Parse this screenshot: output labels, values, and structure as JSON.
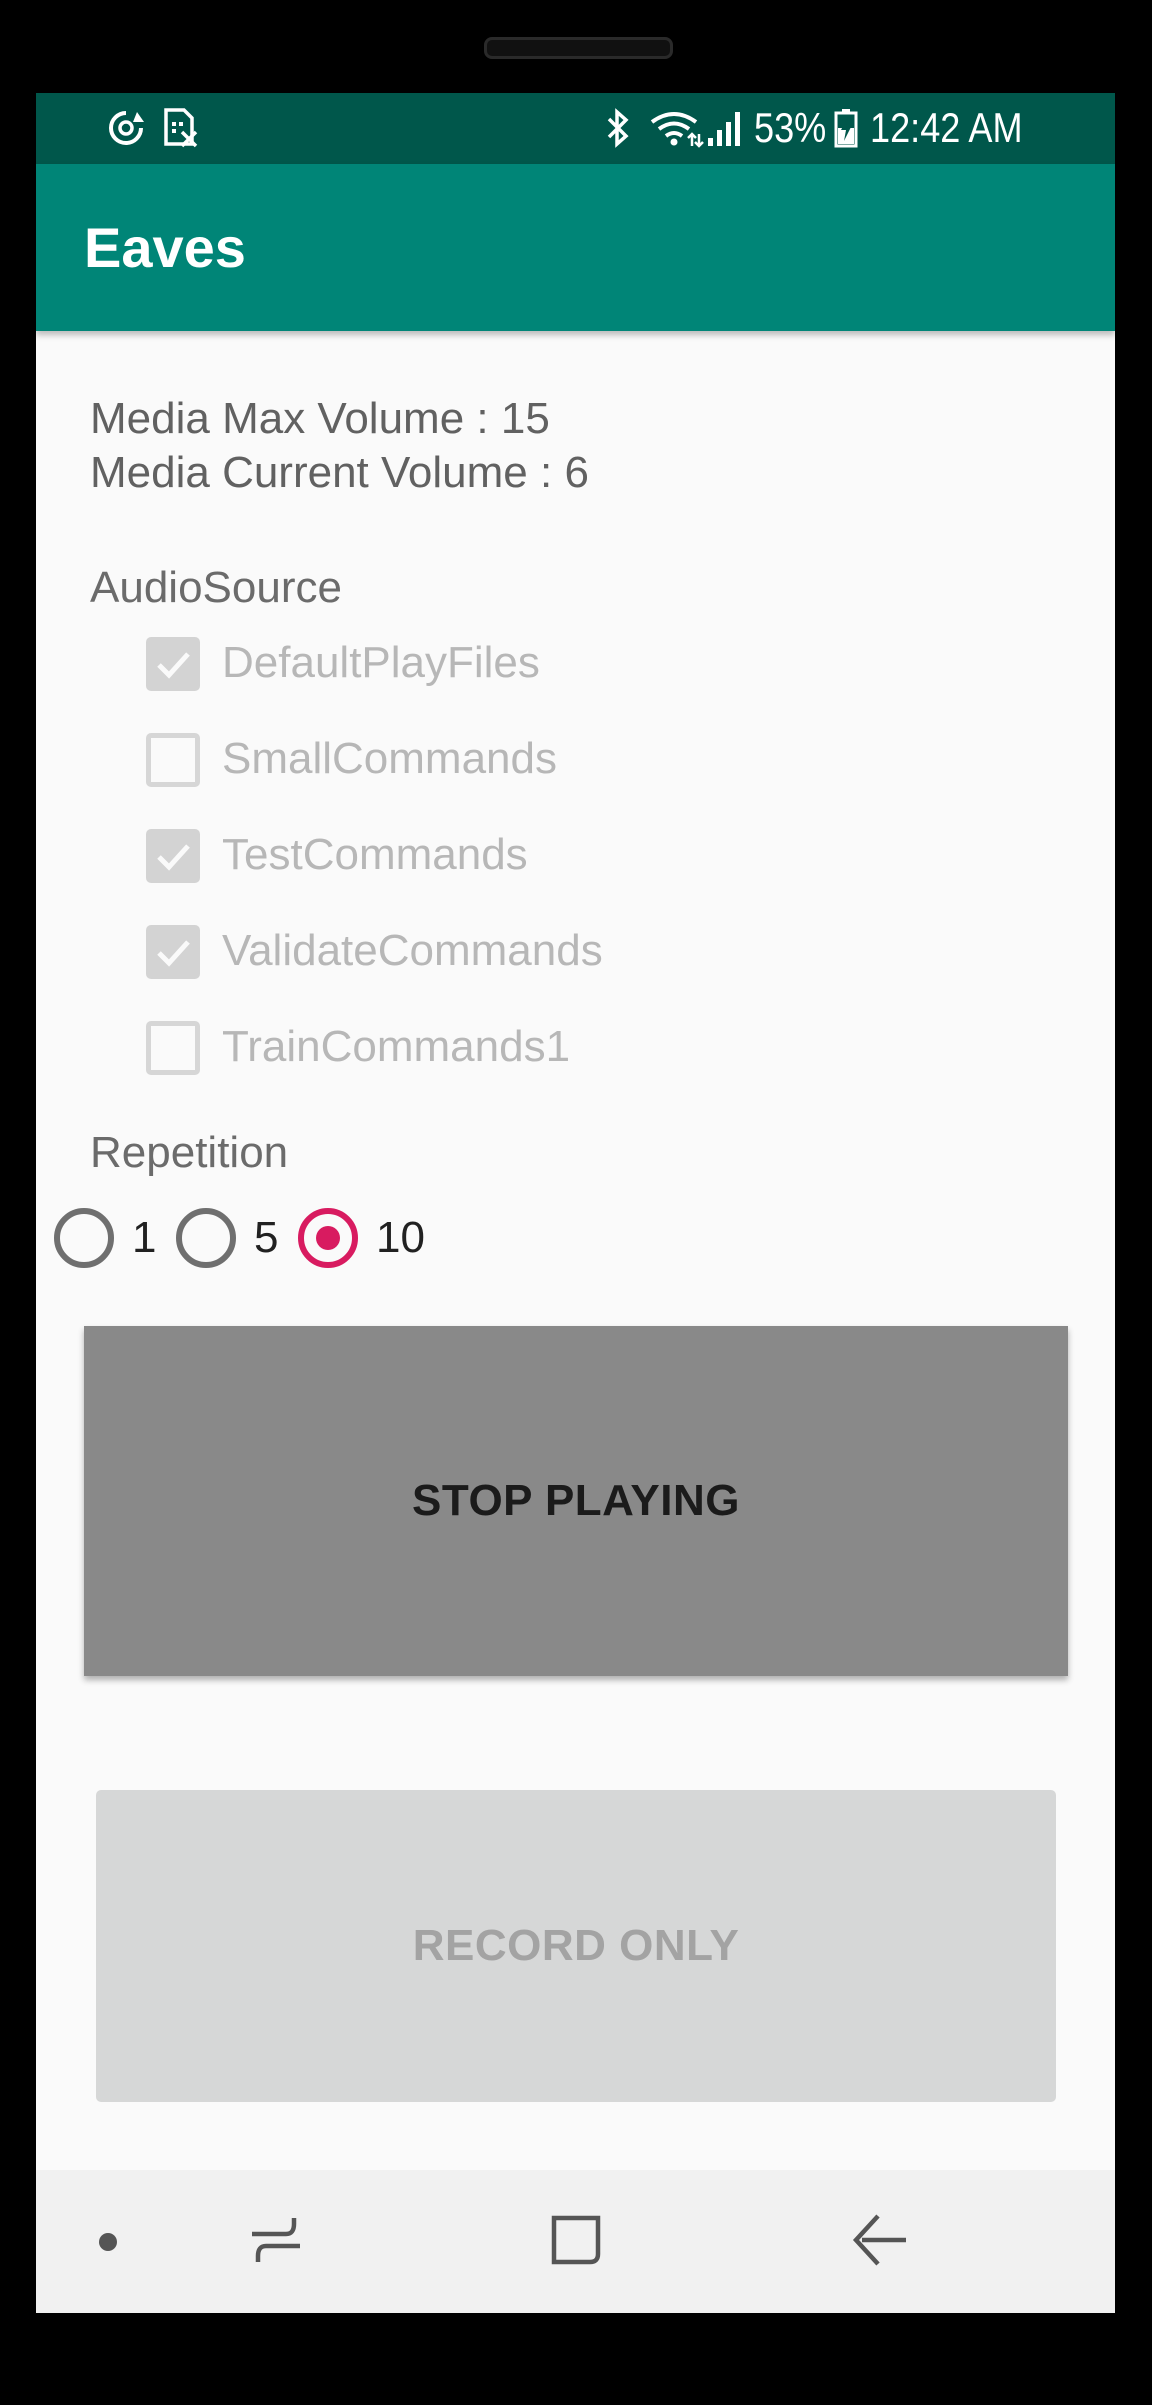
{
  "status_bar": {
    "battery_percent": "53%",
    "time": "12:42 AM",
    "icons": [
      "sync-icon",
      "sim-off-icon",
      "bluetooth-icon",
      "wifi-icon",
      "signal-icon",
      "battery-charging-icon"
    ]
  },
  "app_bar": {
    "title": "Eaves"
  },
  "media": {
    "max_volume_line": "Media Max Volume : 15",
    "current_volume_line": "Media Current Volume : 6"
  },
  "audio_source": {
    "label": "AudioSource",
    "options": [
      {
        "label": "DefaultPlayFiles",
        "checked": true
      },
      {
        "label": "SmallCommands",
        "checked": false
      },
      {
        "label": "TestCommands",
        "checked": true
      },
      {
        "label": "ValidateCommands",
        "checked": true
      },
      {
        "label": "TrainCommands1",
        "checked": false
      }
    ]
  },
  "repetition": {
    "label": "Repetition",
    "options": [
      {
        "label": "1",
        "selected": false
      },
      {
        "label": "5",
        "selected": false
      },
      {
        "label": "10",
        "selected": true
      }
    ]
  },
  "buttons": {
    "stop_playing": "STOP PLAYING",
    "record_only": "RECORD ONLY"
  },
  "nav_bar": {
    "icons": [
      "dot-icon",
      "recent-apps-icon",
      "home-icon",
      "back-icon"
    ]
  },
  "colors": {
    "primary": "#008577",
    "primary_dark": "#00574b",
    "accent": "#d81b60"
  }
}
